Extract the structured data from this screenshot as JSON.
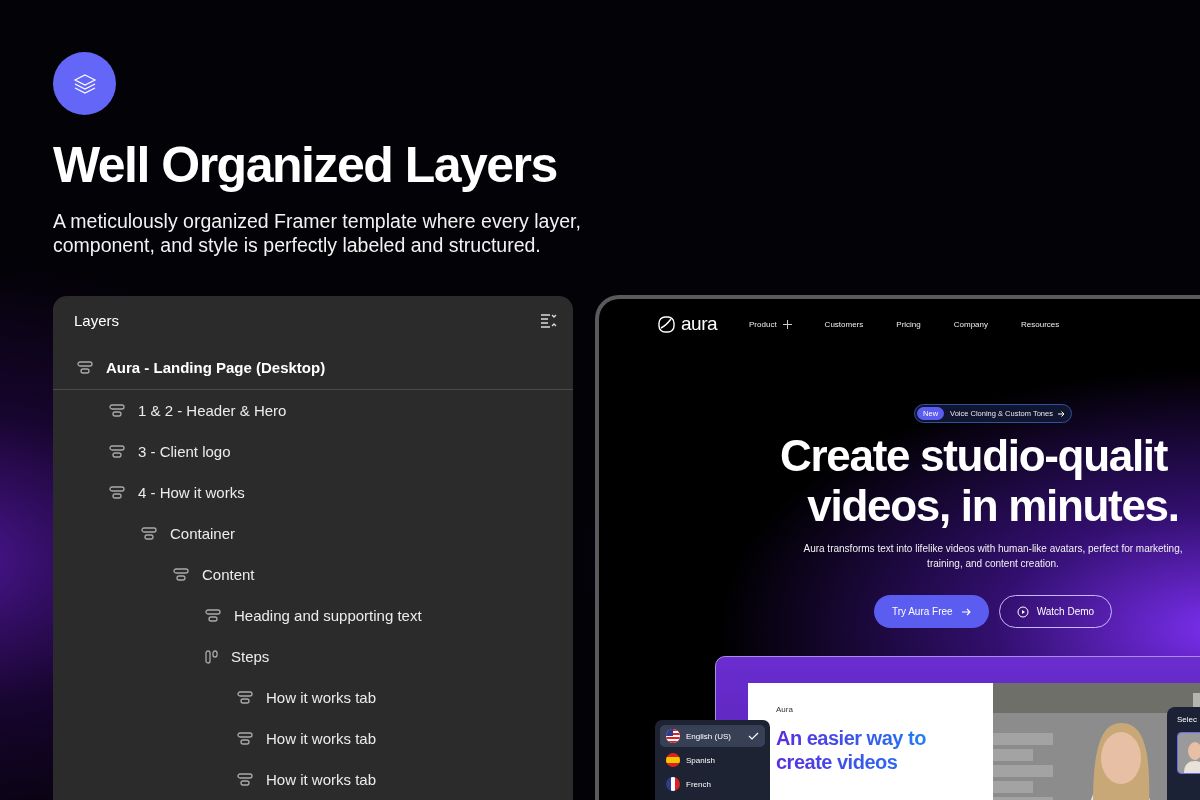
{
  "hero": {
    "title": "Well Organized Layers",
    "description": "A meticulously organized Framer template where every layer, component, and style is perfectly labeled and structured."
  },
  "layers_panel": {
    "title": "Layers",
    "root": {
      "label": "Aura - Landing Page (Desktop)",
      "kind": "stack",
      "children": [
        {
          "label": "1 & 2 - Header & Hero",
          "kind": "stack"
        },
        {
          "label": "3 - Client logo",
          "kind": "stack"
        },
        {
          "label": "4 - How it works",
          "kind": "stack",
          "children": [
            {
              "label": "Container",
              "kind": "stack",
              "children": [
                {
                  "label": "Content",
                  "kind": "stack",
                  "children": [
                    {
                      "label": "Heading and supporting text",
                      "kind": "stack"
                    },
                    {
                      "label": "Steps",
                      "kind": "columns",
                      "children": [
                        {
                          "label": "How it works tab",
                          "kind": "stack"
                        },
                        {
                          "label": "How it works tab",
                          "kind": "stack"
                        },
                        {
                          "label": "How it works tab",
                          "kind": "stack"
                        }
                      ]
                    }
                  ]
                }
              ]
            }
          ]
        }
      ]
    }
  },
  "website": {
    "logo": "aura",
    "nav": [
      {
        "label": "Product",
        "has_menu": true
      },
      {
        "label": "Customers",
        "has_menu": false
      },
      {
        "label": "Pricing",
        "has_menu": false
      },
      {
        "label": "Company",
        "has_menu": false
      },
      {
        "label": "Resources",
        "has_menu": false
      }
    ],
    "announcement": {
      "badge": "New",
      "text": "Voice Cloning & Custom Tones"
    },
    "headline": [
      "Create studio-qualit",
      "videos, in minutes."
    ],
    "subtitle": "Aura transforms text into lifelike videos with human-like avatars, perfect for marketing, training, and content creation.",
    "buttons": [
      {
        "label": "Try Aura Free",
        "kind": "primary"
      },
      {
        "label": "Watch Demo",
        "kind": "outline"
      }
    ],
    "preview": {
      "eyebrow": "Aura",
      "heading": "An easier way to create videos",
      "side_panel_title": "Selec"
    },
    "languages": [
      {
        "label": "English (US)",
        "selected": true,
        "kind": "us"
      },
      {
        "label": "Spanish",
        "selected": false,
        "kind": "es"
      },
      {
        "label": "French",
        "selected": false,
        "kind": "fr"
      }
    ]
  }
}
